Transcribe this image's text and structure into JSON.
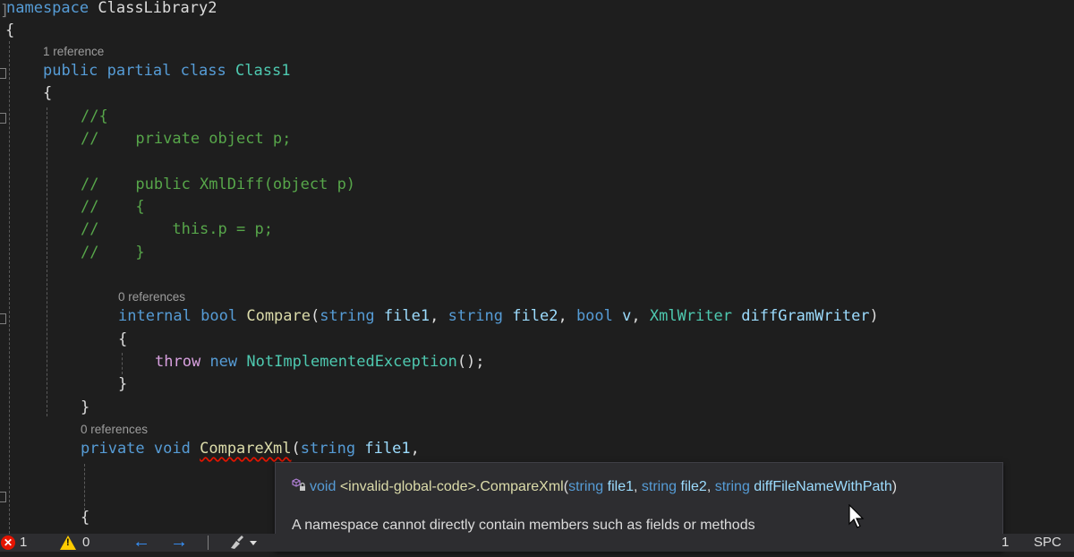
{
  "editor": {
    "namespace_line": {
      "keyword": "namespace",
      "name": "ClassLibrary2"
    },
    "open_brace_1": "{",
    "class_lens": "1 reference",
    "class_line": {
      "kw1": "public",
      "kw2": "partial",
      "kw3": "class",
      "name": "Class1"
    },
    "open_brace_2": "{",
    "comment_lines": [
      "//{",
      "//    private object p;",
      "//    public XmlDiff(object p)",
      "//    {",
      "//        this.p = p;",
      "//    }"
    ],
    "compare_lens": "0 references",
    "compare_sig": {
      "kw_internal": "internal",
      "kw_bool": "bool",
      "name": "Compare",
      "paren_open": "(",
      "t1": "string",
      "p1": "file1",
      "comma1": ", ",
      "t2": "string",
      "p2": "file2",
      "comma2": ", ",
      "t3": "bool",
      "p3": "v",
      "comma3": ", ",
      "t4": "XmlWriter",
      "p4": "diffGramWriter",
      "paren_close": ")"
    },
    "compare_open": "{",
    "throw_line": {
      "kw_throw": "throw",
      "kw_new": "new",
      "type": "NotImplementedException",
      "rest": "();"
    },
    "compare_close": "}",
    "class_close": "}",
    "comparexml_lens": "0 references",
    "comparexml_sig": {
      "kw_private": "private",
      "kw_void": "void",
      "name": "CompareXml",
      "paren": "(",
      "t1": "string",
      "p1": "file1",
      "rest": ","
    },
    "last_brace": "{"
  },
  "tooltip": {
    "sig_void": "void",
    "sig_scope": "<invalid-global-code>",
    "sig_dot": ".",
    "sig_name": "CompareXml",
    "sig_open": "(",
    "sig_t1": "string",
    "sig_p1": "file1",
    "sig_c1": ", ",
    "sig_t2": "string",
    "sig_p2": "file2",
    "sig_c2": ", ",
    "sig_t3": "string",
    "sig_p3": "diffFileNameWithPath",
    "sig_close": ")",
    "message": "A namespace cannot directly contain members such as fields or methods"
  },
  "statusbar": {
    "error_count": "1",
    "warning_count": "0",
    "back_icon": "arrow-left-icon",
    "forward_icon": "arrow-right-icon",
    "cleanup_icon": "brush-icon",
    "line_partial": "1",
    "indent_mode": "SPC"
  },
  "colors": {
    "background": "#1e1e1e",
    "keyword": "#569cd6",
    "control_keyword": "#d8a0df",
    "comment": "#57a64a",
    "type": "#4ec9b0",
    "method": "#dcdcaa",
    "parameter": "#9cdcfe",
    "error": "#e51400",
    "warning": "#ffcc00",
    "nav_arrow": "#3794ff"
  }
}
